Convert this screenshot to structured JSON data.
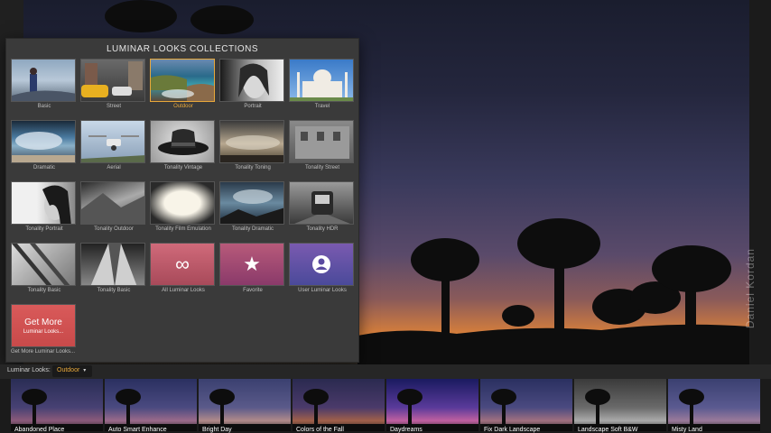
{
  "popup": {
    "title": "LUMINAR LOOKS COLLECTIONS",
    "items": [
      {
        "label": "Basic",
        "icon": "photographer-photo"
      },
      {
        "label": "Street",
        "icon": "street-photo"
      },
      {
        "label": "Outdoor",
        "icon": "coast-photo",
        "selected": true
      },
      {
        "label": "Portrait",
        "icon": "portrait-photo"
      },
      {
        "label": "Travel",
        "icon": "taj-mahal-photo"
      },
      {
        "label": "Dramatic",
        "icon": "storm-photo"
      },
      {
        "label": "Aerial",
        "icon": "drone-photo"
      },
      {
        "label": "Tonality Vintage",
        "icon": "hat-photo"
      },
      {
        "label": "Tonality Toning",
        "icon": "clouds-photo"
      },
      {
        "label": "Tonality Street",
        "icon": "building-photo"
      },
      {
        "label": "Tonality Portrait",
        "icon": "bw-portrait-photo"
      },
      {
        "label": "Tonality Outdoor",
        "icon": "bw-landscape-photo"
      },
      {
        "label": "Tonality Film Emulation",
        "icon": "film-frame-photo"
      },
      {
        "label": "Tonality Dramatic",
        "icon": "bw-storm-photo"
      },
      {
        "label": "Tonality HDR",
        "icon": "subway-photo"
      },
      {
        "label": "Tonality Basic",
        "icon": "bw-window-photo"
      },
      {
        "label": "Tonality Basic",
        "icon": "skyscraper-photo"
      },
      {
        "label": "All Luminar Looks",
        "icon": "infinity-icon"
      },
      {
        "label": "Favorite",
        "icon": "star-icon"
      },
      {
        "label": "User Luminar Looks",
        "icon": "user-icon"
      }
    ],
    "get_more": {
      "title": "Get More",
      "subtitle": "Luminar Looks...",
      "label": "Get More Luminar Looks..."
    }
  },
  "looks_bar": {
    "label": "Luminar Looks:",
    "selected": "Outdoor"
  },
  "filmstrip": [
    {
      "label": "Abandoned Place"
    },
    {
      "label": "Auto Smart Enhance"
    },
    {
      "label": "Bright Day"
    },
    {
      "label": "Colors of the Fall"
    },
    {
      "label": "Daydreams"
    },
    {
      "label": "Fix Dark Landscape"
    },
    {
      "label": "Landscape Soft B&W"
    },
    {
      "label": "Misty Land"
    }
  ],
  "photo_credit": "Daniel Kordan",
  "colors": {
    "accent": "#e8a83a",
    "favorite_tile": "#b04a6a",
    "all_looks_tile": "#c45a6a",
    "user_tile": "#5a5aa8",
    "get_more_tile": "#d35656"
  }
}
